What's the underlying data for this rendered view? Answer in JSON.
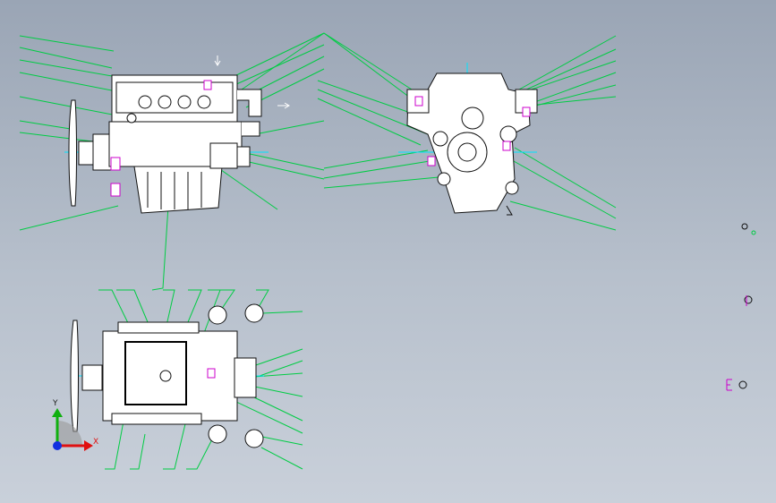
{
  "viewport": {
    "background_top": "#9aa5b5",
    "background_bottom": "#c9d0da"
  },
  "colors": {
    "leader": "#00cc44",
    "part": "#101010",
    "centerline": "#00e5ff",
    "highlight": "#cc00cc",
    "view_white": "#ffffff"
  },
  "triad": {
    "x_label": "X",
    "y_label": "Y",
    "x_color": "#e01010",
    "y_color": "#10b010",
    "z_color": "#1030e0"
  },
  "views": [
    {
      "id": "side-view",
      "name": "engine-side-view"
    },
    {
      "id": "front-view",
      "name": "engine-front-view"
    },
    {
      "id": "top-view",
      "name": "engine-top-view"
    }
  ]
}
